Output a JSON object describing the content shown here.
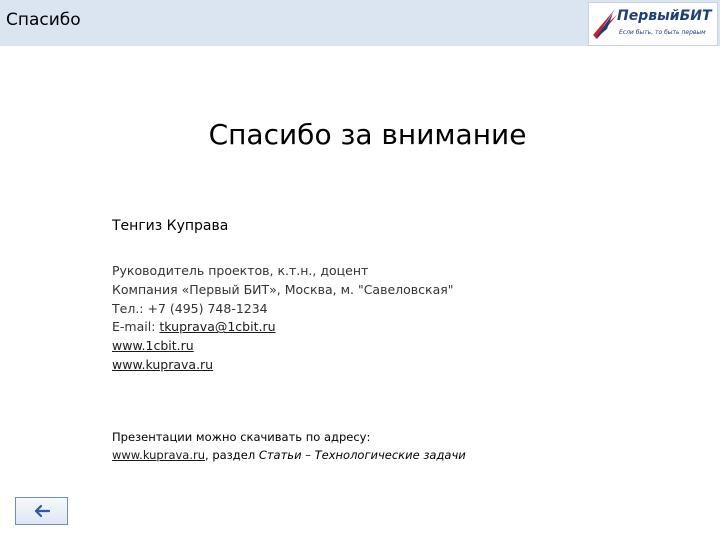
{
  "header": {
    "title": "Спасибо",
    "logo": {
      "name": "ПервыйБИТ",
      "tagline": "Если быть, то быть первым"
    }
  },
  "main": {
    "title": "Спасибо за внимание",
    "name": "Тенгиз Куправа",
    "role": "Руководитель проектов, к.т.н., доцент",
    "company": "Компания «Первый БИТ», Москва, м. \"Савеловская\"",
    "phone": "Тел.: +7 (495) 748-1234",
    "email_label": "E-mail: ",
    "email": "tkuprava@1cbit.ru",
    "link1": "www.1cbit.ru",
    "link2": "www.kuprava.ru"
  },
  "footer": {
    "line1": "Презентации можно скачивать по адресу:",
    "link": "www.kuprava.ru",
    "mid": ", раздел ",
    "section": "Статьи – Технологические задачи"
  },
  "nav": {
    "back_icon": "arrow-left-icon"
  },
  "colors": {
    "header_bg": "#dbe5f1",
    "logo_blue": "#1f3f7a",
    "logo_red": "#c8202f"
  }
}
